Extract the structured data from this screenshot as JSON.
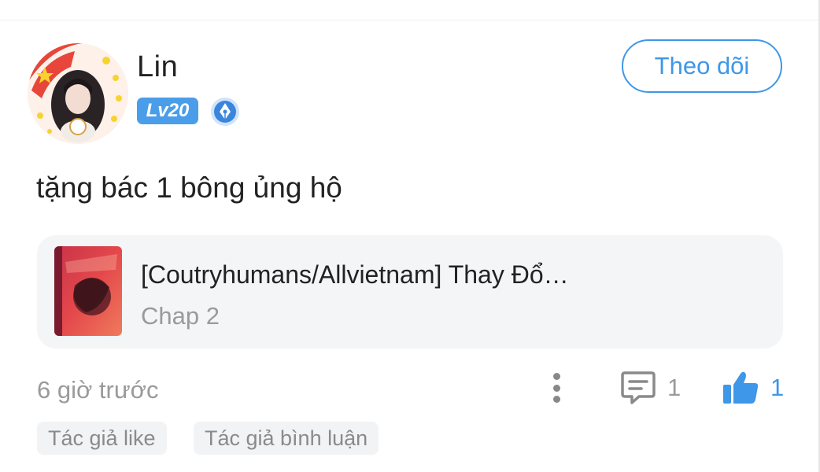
{
  "user": {
    "name": "Lin",
    "level": "Lv20",
    "avatar_icon": "user-avatar",
    "medal_icon": "pen-nib-medal-icon"
  },
  "actions": {
    "follow_label": "Theo dõi"
  },
  "post": {
    "text": "tặng bác 1 bông ủng hộ",
    "timestamp": "6 giờ trước"
  },
  "story": {
    "title": "[Coutryhumans/Allvietnam] Thay Đổ…",
    "chapter": "Chap 2"
  },
  "stats": {
    "comments": "1",
    "likes": "1"
  },
  "tags": [
    {
      "label": "Tác giả like"
    },
    {
      "label": "Tác giả bình luận"
    }
  ],
  "colors": {
    "accent": "#3e97e8",
    "badge": "#4a9ee9",
    "muted_text": "#9a9a9a",
    "card_bg": "#f4f5f7"
  }
}
